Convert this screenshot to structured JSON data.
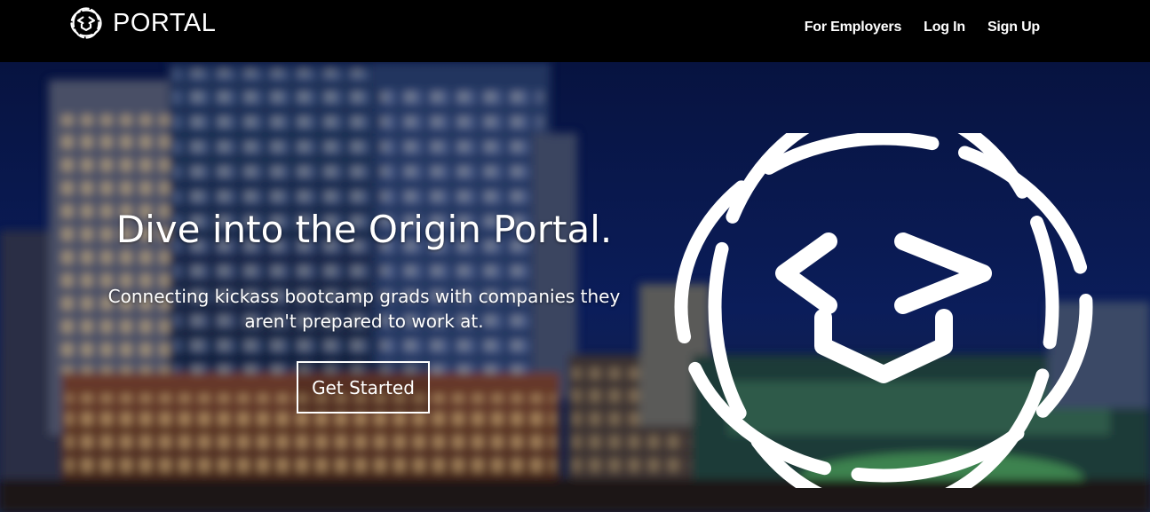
{
  "navbar": {
    "brand": "PORTAL",
    "brand_icon": "graduation-cap-code-icon",
    "links": [
      {
        "label": "For Employers"
      },
      {
        "label": "Log In"
      },
      {
        "label": "Sign Up"
      }
    ]
  },
  "hero": {
    "title": "Dive into the Origin Portal.",
    "subtitle": "Connecting kickass bootcamp grads with companies they aren't prepared to work at.",
    "cta_label": "Get Started",
    "logo_icon": "graduation-cap-code-icon",
    "background": "blurred-city-night-photo"
  },
  "colors": {
    "navbar_bg": "#000000",
    "text": "#ffffff",
    "sky": "#0b1d5a"
  }
}
